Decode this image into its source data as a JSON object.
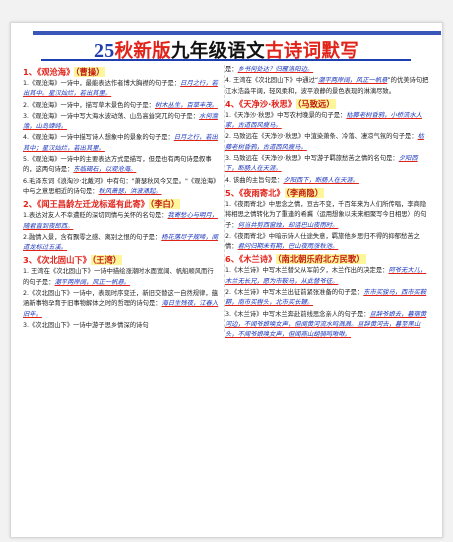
{
  "title": {
    "num": "25",
    "p1": "秋新版",
    "p2": "九年级语文",
    "p3": "古诗词默写"
  },
  "left": [
    {
      "type": "sec",
      "head": "1、《观沧海》",
      "author": "（曹操）"
    },
    {
      "type": "item",
      "q": "1.《观沧海》一诗中，最能表达作者博大胸襟的句子是：",
      "a": "日月之行，若出其中。星汉灿烂，若出其里。",
      "e": ""
    },
    {
      "type": "item",
      "q": "2.《观沧海》一诗中，描写草木景色的句子是：",
      "a": "树木丛生，百草丰茂。",
      "e": ""
    },
    {
      "type": "item",
      "q": "3.《观沧海》一诗中写大海水波动荡、山岛高耸突兀的句子是：",
      "a": "水何澹澹，山岛竦峙。",
      "e": ""
    },
    {
      "type": "item",
      "q": "4.《观沧海》一诗中描写诗人想象中的景象的句子是：",
      "a": "日月之行，若出其中；星汉灿烂，若出其里。",
      "e": ""
    },
    {
      "type": "item",
      "q": "5.《观沧海》一诗中的主要表达方式是描写，但是也有两句诗是叙事的，这两句诗是：",
      "a": "东临碣石，以观沧海。",
      "e": ""
    },
    {
      "type": "item",
      "q": "6.毛泽东词《浪淘沙·北戴河》中有句：\"萧瑟秋风今又是。\"《观沧海》中与之意思相近的诗句是：",
      "a": "秋风萧瑟，洪波涌起。",
      "e": ""
    },
    {
      "type": "sec",
      "head": "2、《闻王昌龄左迁龙标遥有此寄》",
      "author": "（李白）"
    },
    {
      "type": "item",
      "q": "1.表达对友人不幸遭贬的深切同情与关怀的名句是：",
      "a": "我寄愁心与明月，随君直到夜郎西。",
      "e": ""
    },
    {
      "type": "item",
      "q": "2.融情入景，含有飘零之感、离别之恨的句子是：",
      "a": "杨花落尽子规啼，闻道龙标过五溪。",
      "e": ""
    },
    {
      "type": "sec",
      "head": "3、《次北固山下》",
      "author": "（王湾）"
    },
    {
      "type": "item",
      "q": "1. 王湾在《次北固山下》一诗中描绘涨潮时水面宽阔、帆船顺风而行的句子是：",
      "a": "潮平两岸阔，风正一帆悬。",
      "e": ""
    },
    {
      "type": "item",
      "q": "2.《次北固山下》一诗中，表现时序变迁，新旧交替这一自然规律，蕴涵新事物孕育于旧事物解体之时的哲理的诗句是：",
      "a": "海日生残夜，江春入旧年。",
      "e": ""
    },
    {
      "type": "item",
      "q": "3.《次北固山下》一诗中游子思乡情深的诗句",
      "a": "",
      "e": ""
    }
  ],
  "right": [
    {
      "type": "item",
      "q": "是：",
      "a": "乡书何处达？归雁洛阳边。",
      "e": ""
    },
    {
      "type": "item",
      "q": "4. 王湾在《次北固山下》中通过“",
      "a": "潮平两岸阔，风正一帆悬",
      "e": "”的优美诗句把江水浩淼平阔，轻风柔和，波平浪静的景色表现的淋漓尽致。"
    },
    {
      "type": "sec",
      "head": "4、《天净沙·秋思》",
      "author": "（马致远）"
    },
    {
      "type": "item",
      "q": "1.《天净沙·秋思》中写农村晚景的句子是：",
      "a": "枯藤老树昏鸦，小桥流水人家，古道西风瘦马。",
      "e": ""
    },
    {
      "type": "item",
      "q": "2. 马致远在《天净沙·秋思》中渲染萧条、冷落、凄凉气氛的句子是：",
      "a": "枯藤老树昏鸦，古道西风瘦马。",
      "e": ""
    },
    {
      "type": "item",
      "q": "3. 马致远在《天净沙·秋思》中写游子羁旅愁苦之情的名句是：",
      "a": "夕阳西下，断肠人在天涯。",
      "e": ""
    },
    {
      "type": "item",
      "q": "4. 该曲的主旨句是：",
      "a": "夕阳西下，断肠人在天涯。",
      "e": ""
    },
    {
      "type": "sec",
      "head": "5、《夜雨寄北》",
      "author": "（李商隐）"
    },
    {
      "type": "item",
      "q": "1.《夜雨寄北》中思念之情，亘古不变，千百年来为人们所传唱，李商隐将相思之情转化为了重逢的希冀（运用想象以未来相聚写今日相思）的句子：",
      "a": "何当共剪西窗烛，却话巴山夜雨时。",
      "e": ""
    },
    {
      "type": "item",
      "q": "2.《夜雨寄北》中暗示诗人仕途失意，羁旅他乡思归不得的抑郁愁苦之情：",
      "a": "君问归期未有期，巴山夜雨涨秋池。",
      "e": ""
    },
    {
      "type": "sec",
      "head": "6、《木兰诗》",
      "author": "（南北朝乐府北方民歌）"
    },
    {
      "type": "item",
      "q": "1.《木兰诗》中写木兰替父从军前夕，木兰作出的决定是：",
      "a": "阿爷无大儿，木兰无长兄，愿为市鞍马，从此替爷征。",
      "e": ""
    },
    {
      "type": "item",
      "q": "2.《木兰诗》中写木兰出征前紧张准备的句子是：",
      "a": "东市买骏马，西市买鞍鞯，南市买辔头，北市买长鞭。",
      "e": ""
    },
    {
      "type": "item",
      "q": "3.《木兰诗》中写木兰奔赴前线思念亲人的句子是：",
      "a": "旦辞爷娘去，暮宿黄河边，不闻爷娘唤女声，但闻黄河流水鸣溅溅。旦辞黄河去，暮至黑山头，不闻爷娘唤女声，但闻燕山胡骑鸣啾啾。",
      "e": ""
    }
  ]
}
